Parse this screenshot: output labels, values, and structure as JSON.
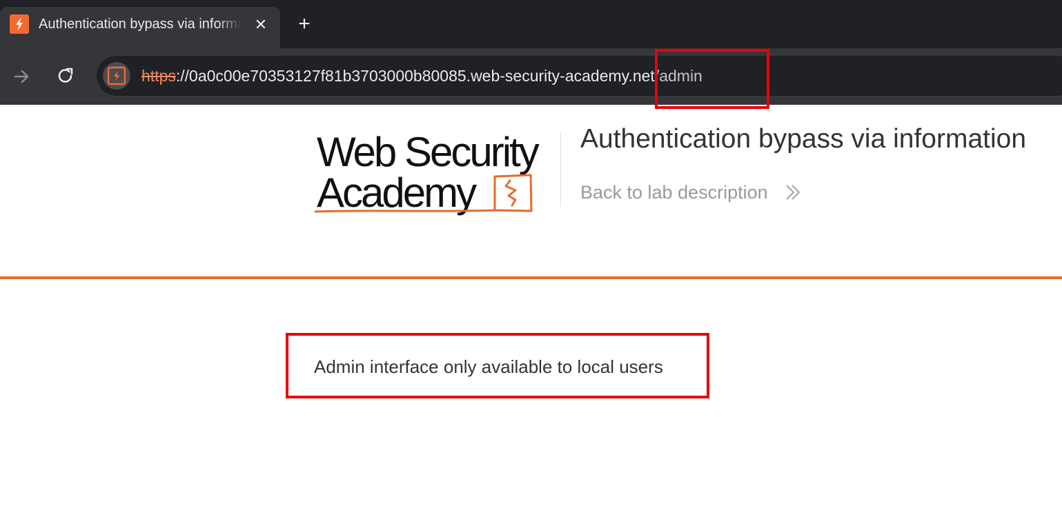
{
  "browser": {
    "tab": {
      "title": "Authentication bypass via information disclosure",
      "favicon": "web-security-academy-icon",
      "close_icon": "close-icon"
    },
    "new_tab_icon": "plus-icon",
    "nav": {
      "forward_icon": "arrow-right-icon",
      "reload_icon": "reload-icon"
    },
    "address_bar": {
      "site_info_icon": "web-security-academy-icon",
      "scheme": "https",
      "separator": "://",
      "host": "0a0c00e70353127f81b3703000b80085.web-security-academy.net",
      "path": "/admin"
    }
  },
  "page": {
    "logo": {
      "line1": "Web Security",
      "line2": "Academy"
    },
    "lab_title": "Authentication bypass via information",
    "back_link": "Back to lab description",
    "back_icon": "double-chevron-right-icon",
    "message": "Admin interface only available to local users"
  },
  "colors": {
    "accent": "#e86a2c",
    "annotation": "#e8000b",
    "chrome_dark": "#202124",
    "chrome_mid": "#35363a"
  }
}
